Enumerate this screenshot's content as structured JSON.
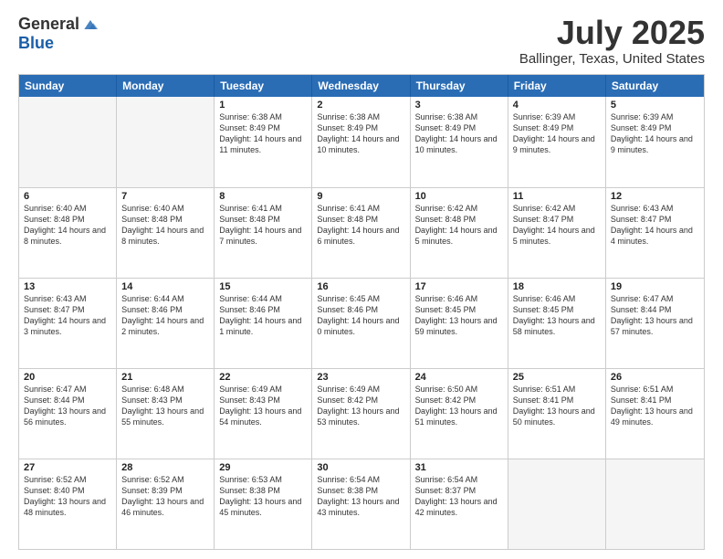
{
  "logo": {
    "general": "General",
    "blue": "Blue"
  },
  "title": "July 2025",
  "location": "Ballinger, Texas, United States",
  "days_of_week": [
    "Sunday",
    "Monday",
    "Tuesday",
    "Wednesday",
    "Thursday",
    "Friday",
    "Saturday"
  ],
  "weeks": [
    [
      {
        "day": "",
        "empty": true
      },
      {
        "day": "",
        "empty": true
      },
      {
        "day": "1",
        "sunrise": "Sunrise: 6:38 AM",
        "sunset": "Sunset: 8:49 PM",
        "daylight": "Daylight: 14 hours and 11 minutes."
      },
      {
        "day": "2",
        "sunrise": "Sunrise: 6:38 AM",
        "sunset": "Sunset: 8:49 PM",
        "daylight": "Daylight: 14 hours and 10 minutes."
      },
      {
        "day": "3",
        "sunrise": "Sunrise: 6:38 AM",
        "sunset": "Sunset: 8:49 PM",
        "daylight": "Daylight: 14 hours and 10 minutes."
      },
      {
        "day": "4",
        "sunrise": "Sunrise: 6:39 AM",
        "sunset": "Sunset: 8:49 PM",
        "daylight": "Daylight: 14 hours and 9 minutes."
      },
      {
        "day": "5",
        "sunrise": "Sunrise: 6:39 AM",
        "sunset": "Sunset: 8:49 PM",
        "daylight": "Daylight: 14 hours and 9 minutes."
      }
    ],
    [
      {
        "day": "6",
        "sunrise": "Sunrise: 6:40 AM",
        "sunset": "Sunset: 8:48 PM",
        "daylight": "Daylight: 14 hours and 8 minutes."
      },
      {
        "day": "7",
        "sunrise": "Sunrise: 6:40 AM",
        "sunset": "Sunset: 8:48 PM",
        "daylight": "Daylight: 14 hours and 8 minutes."
      },
      {
        "day": "8",
        "sunrise": "Sunrise: 6:41 AM",
        "sunset": "Sunset: 8:48 PM",
        "daylight": "Daylight: 14 hours and 7 minutes."
      },
      {
        "day": "9",
        "sunrise": "Sunrise: 6:41 AM",
        "sunset": "Sunset: 8:48 PM",
        "daylight": "Daylight: 14 hours and 6 minutes."
      },
      {
        "day": "10",
        "sunrise": "Sunrise: 6:42 AM",
        "sunset": "Sunset: 8:48 PM",
        "daylight": "Daylight: 14 hours and 5 minutes."
      },
      {
        "day": "11",
        "sunrise": "Sunrise: 6:42 AM",
        "sunset": "Sunset: 8:47 PM",
        "daylight": "Daylight: 14 hours and 5 minutes."
      },
      {
        "day": "12",
        "sunrise": "Sunrise: 6:43 AM",
        "sunset": "Sunset: 8:47 PM",
        "daylight": "Daylight: 14 hours and 4 minutes."
      }
    ],
    [
      {
        "day": "13",
        "sunrise": "Sunrise: 6:43 AM",
        "sunset": "Sunset: 8:47 PM",
        "daylight": "Daylight: 14 hours and 3 minutes."
      },
      {
        "day": "14",
        "sunrise": "Sunrise: 6:44 AM",
        "sunset": "Sunset: 8:46 PM",
        "daylight": "Daylight: 14 hours and 2 minutes."
      },
      {
        "day": "15",
        "sunrise": "Sunrise: 6:44 AM",
        "sunset": "Sunset: 8:46 PM",
        "daylight": "Daylight: 14 hours and 1 minute."
      },
      {
        "day": "16",
        "sunrise": "Sunrise: 6:45 AM",
        "sunset": "Sunset: 8:46 PM",
        "daylight": "Daylight: 14 hours and 0 minutes."
      },
      {
        "day": "17",
        "sunrise": "Sunrise: 6:46 AM",
        "sunset": "Sunset: 8:45 PM",
        "daylight": "Daylight: 13 hours and 59 minutes."
      },
      {
        "day": "18",
        "sunrise": "Sunrise: 6:46 AM",
        "sunset": "Sunset: 8:45 PM",
        "daylight": "Daylight: 13 hours and 58 minutes."
      },
      {
        "day": "19",
        "sunrise": "Sunrise: 6:47 AM",
        "sunset": "Sunset: 8:44 PM",
        "daylight": "Daylight: 13 hours and 57 minutes."
      }
    ],
    [
      {
        "day": "20",
        "sunrise": "Sunrise: 6:47 AM",
        "sunset": "Sunset: 8:44 PM",
        "daylight": "Daylight: 13 hours and 56 minutes."
      },
      {
        "day": "21",
        "sunrise": "Sunrise: 6:48 AM",
        "sunset": "Sunset: 8:43 PM",
        "daylight": "Daylight: 13 hours and 55 minutes."
      },
      {
        "day": "22",
        "sunrise": "Sunrise: 6:49 AM",
        "sunset": "Sunset: 8:43 PM",
        "daylight": "Daylight: 13 hours and 54 minutes."
      },
      {
        "day": "23",
        "sunrise": "Sunrise: 6:49 AM",
        "sunset": "Sunset: 8:42 PM",
        "daylight": "Daylight: 13 hours and 53 minutes."
      },
      {
        "day": "24",
        "sunrise": "Sunrise: 6:50 AM",
        "sunset": "Sunset: 8:42 PM",
        "daylight": "Daylight: 13 hours and 51 minutes."
      },
      {
        "day": "25",
        "sunrise": "Sunrise: 6:51 AM",
        "sunset": "Sunset: 8:41 PM",
        "daylight": "Daylight: 13 hours and 50 minutes."
      },
      {
        "day": "26",
        "sunrise": "Sunrise: 6:51 AM",
        "sunset": "Sunset: 8:41 PM",
        "daylight": "Daylight: 13 hours and 49 minutes."
      }
    ],
    [
      {
        "day": "27",
        "sunrise": "Sunrise: 6:52 AM",
        "sunset": "Sunset: 8:40 PM",
        "daylight": "Daylight: 13 hours and 48 minutes."
      },
      {
        "day": "28",
        "sunrise": "Sunrise: 6:52 AM",
        "sunset": "Sunset: 8:39 PM",
        "daylight": "Daylight: 13 hours and 46 minutes."
      },
      {
        "day": "29",
        "sunrise": "Sunrise: 6:53 AM",
        "sunset": "Sunset: 8:38 PM",
        "daylight": "Daylight: 13 hours and 45 minutes."
      },
      {
        "day": "30",
        "sunrise": "Sunrise: 6:54 AM",
        "sunset": "Sunset: 8:38 PM",
        "daylight": "Daylight: 13 hours and 43 minutes."
      },
      {
        "day": "31",
        "sunrise": "Sunrise: 6:54 AM",
        "sunset": "Sunset: 8:37 PM",
        "daylight": "Daylight: 13 hours and 42 minutes."
      },
      {
        "day": "",
        "empty": true
      },
      {
        "day": "",
        "empty": true
      }
    ]
  ]
}
